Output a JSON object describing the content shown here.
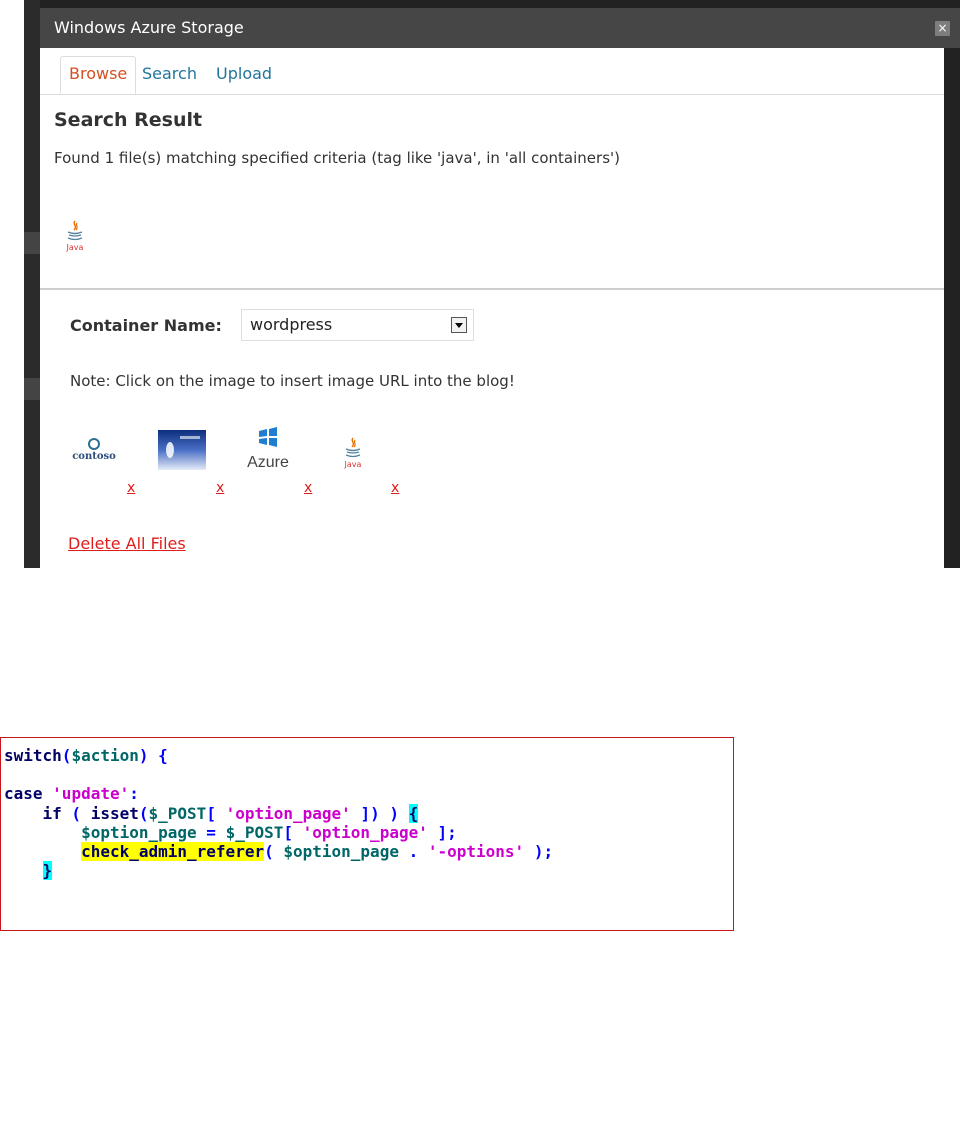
{
  "window": {
    "title": "Windows Azure Storage",
    "close_glyph": "×"
  },
  "tabs": [
    {
      "label": "Browse",
      "active": true
    },
    {
      "label": "Search",
      "active": false
    },
    {
      "label": "Upload",
      "active": false
    }
  ],
  "search_result": {
    "heading": "Search Result",
    "summary": "Found 1 file(s) matching specified criteria (tag like 'java', in 'all containers')",
    "java_logo_text": "Java"
  },
  "browse": {
    "container_label": "Container Name:",
    "container_value": "wordpress",
    "note": "Note: Click on the image to insert image URL into the blog!",
    "images": [
      {
        "icon": "contoso-logo",
        "logo_text": "contoso",
        "delete_label": "x"
      },
      {
        "icon": "vdist-logo",
        "logo_text": "",
        "delete_label": "x"
      },
      {
        "icon": "azure-logo",
        "logo_text": "Azure",
        "delete_label": "x"
      },
      {
        "icon": "java-logo",
        "logo_text": "Java",
        "delete_label": "x"
      }
    ],
    "delete_all": "Delete All Files"
  },
  "colors": {
    "tab_active": "#d54e21",
    "tab_link": "#21759b",
    "delete_red": "#e01d1d",
    "code_border": "#c8151b"
  },
  "code": {
    "lines": [
      "switch($action) {",
      "",
      "case 'update':",
      "    if ( isset($_POST[ 'option_page' ]) ) {",
      "        $option_page = $_POST[ 'option_page' ];",
      "        check_admin_referer( $option_page . '-options' );",
      "    }"
    ]
  }
}
